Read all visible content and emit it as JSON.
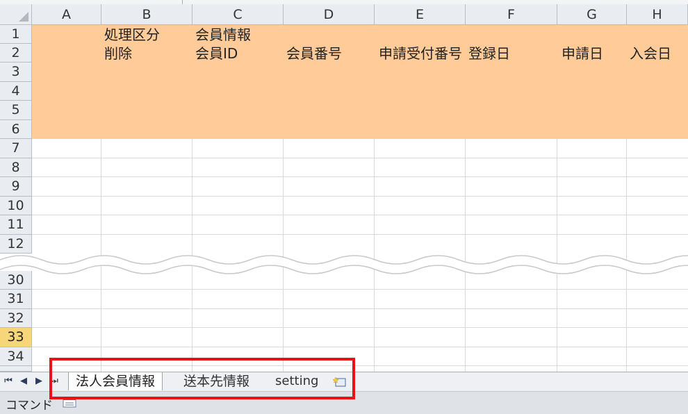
{
  "columns": [
    "A",
    "B",
    "C",
    "D",
    "E",
    "F",
    "G",
    "H"
  ],
  "rows_top": [
    "1",
    "2",
    "3",
    "4",
    "5",
    "6",
    "7",
    "8",
    "9",
    "10",
    "11",
    "12"
  ],
  "rows_bottom": [
    "30",
    "31",
    "32",
    "33",
    "34"
  ],
  "selected_row": "33",
  "header_cells": {
    "B1": "処理区分",
    "B2": "削除",
    "C1": "会員情報",
    "C2": "会員ID",
    "D2": "会員番号",
    "E2": "申請受付番号",
    "F2": "登録日",
    "G2": "申請日",
    "H2": "入会日"
  },
  "tabs": [
    "法人会員情報",
    "送本先情報",
    "setting"
  ],
  "status": "コマンド",
  "colors": {
    "header_band": "#ffcc99",
    "highlight_box": "#e8121b",
    "selected_row": "#f7d67a"
  }
}
